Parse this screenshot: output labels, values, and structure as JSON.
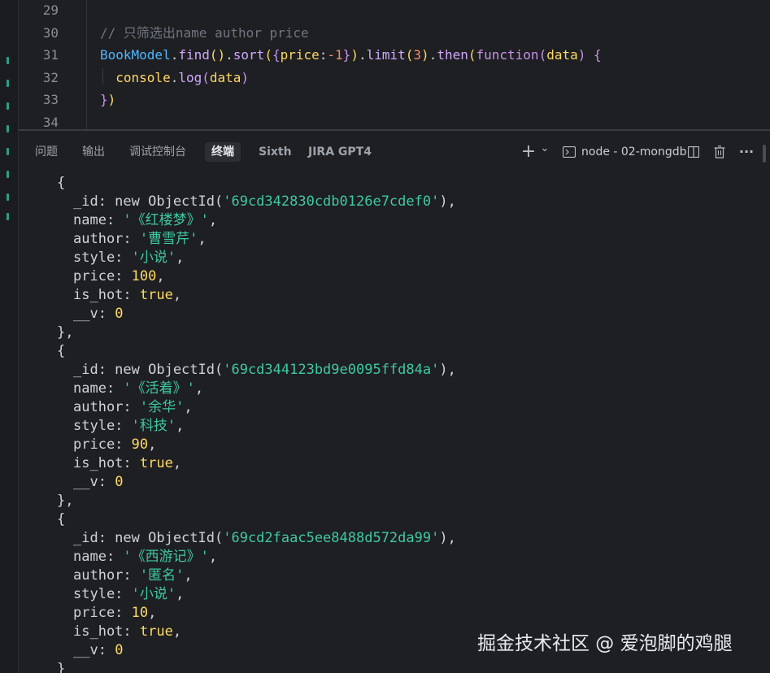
{
  "editor": {
    "lines": [
      {
        "no": "29",
        "segments": []
      },
      {
        "no": "30",
        "segments": [
          {
            "t": "// 只筛选出name author price",
            "c": "cm"
          }
        ]
      },
      {
        "no": "31",
        "segments": [
          {
            "t": "BookModel",
            "c": "cls"
          },
          {
            "t": ".",
            "c": "plain"
          },
          {
            "t": "find",
            "c": "fn"
          },
          {
            "t": "()",
            "c": "pn"
          },
          {
            "t": ".",
            "c": "plain"
          },
          {
            "t": "sort",
            "c": "fn"
          },
          {
            "t": "(",
            "c": "pn"
          },
          {
            "t": "{",
            "c": "fn2"
          },
          {
            "t": "price",
            "c": "pk"
          },
          {
            "t": ":",
            "c": "plain"
          },
          {
            "t": "-1",
            "c": "num"
          },
          {
            "t": "}",
            "c": "fn2"
          },
          {
            "t": ")",
            "c": "pn"
          },
          {
            "t": ".",
            "c": "plain"
          },
          {
            "t": "limit",
            "c": "fn"
          },
          {
            "t": "(",
            "c": "pn"
          },
          {
            "t": "3",
            "c": "num"
          },
          {
            "t": ")",
            "c": "pn"
          },
          {
            "t": ".",
            "c": "plain"
          },
          {
            "t": "then",
            "c": "fn"
          },
          {
            "t": "(",
            "c": "pn"
          },
          {
            "t": "function",
            "c": "kw"
          },
          {
            "t": "(",
            "c": "fn2"
          },
          {
            "t": "data",
            "c": "pk"
          },
          {
            "t": ")",
            "c": "fn2"
          },
          {
            "t": " ",
            "c": "plain"
          },
          {
            "t": "{",
            "c": "fn2"
          }
        ]
      },
      {
        "no": "32",
        "segments": [
          {
            "t": "  ",
            "c": "plain"
          },
          {
            "t": "console",
            "c": "pk"
          },
          {
            "t": ".",
            "c": "plain"
          },
          {
            "t": "log",
            "c": "fn"
          },
          {
            "t": "(",
            "c": "fn2"
          },
          {
            "t": "data",
            "c": "pk"
          },
          {
            "t": ")",
            "c": "fn2"
          }
        ]
      },
      {
        "no": "33",
        "segments": [
          {
            "t": "}",
            "c": "fn2"
          },
          {
            "t": ")",
            "c": "pn"
          }
        ]
      },
      {
        "no": "34",
        "segments": []
      }
    ]
  },
  "panel": {
    "tabs": [
      {
        "label": "问题",
        "active": false
      },
      {
        "label": "输出",
        "active": false
      },
      {
        "label": "调试控制台",
        "active": false
      },
      {
        "label": "终端",
        "active": true
      },
      {
        "label": "Sixth",
        "active": false
      },
      {
        "label": "JIRA GPT4",
        "active": false
      }
    ],
    "add_icon": "+",
    "dropdown_icon": "⌄",
    "terminal_icon": "terminal-icon",
    "terminal_name": "node - 02-mongdb",
    "split_icon": "◫",
    "trash_icon": "🗑",
    "more_icon": "···"
  },
  "terminal": {
    "lines": [
      {
        "indent": 2,
        "segments": [
          {
            "t": "{",
            "c": ""
          }
        ]
      },
      {
        "indent": 4,
        "segments": [
          {
            "t": "_id: new ObjectId(",
            "c": ""
          },
          {
            "t": "'69cd342830cdb0126e7cdef0'",
            "c": "tstr"
          },
          {
            "t": "),",
            "c": ""
          }
        ]
      },
      {
        "indent": 4,
        "segments": [
          {
            "t": "name: ",
            "c": ""
          },
          {
            "t": "'《红楼梦》'",
            "c": "tstr"
          },
          {
            "t": ",",
            "c": ""
          }
        ]
      },
      {
        "indent": 4,
        "segments": [
          {
            "t": "author: ",
            "c": ""
          },
          {
            "t": "'曹雪芹'",
            "c": "tstr"
          },
          {
            "t": ",",
            "c": ""
          }
        ]
      },
      {
        "indent": 4,
        "segments": [
          {
            "t": "style: ",
            "c": ""
          },
          {
            "t": "'小说'",
            "c": "tstr"
          },
          {
            "t": ",",
            "c": ""
          }
        ]
      },
      {
        "indent": 4,
        "segments": [
          {
            "t": "price: ",
            "c": ""
          },
          {
            "t": "100",
            "c": "tnum"
          },
          {
            "t": ",",
            "c": ""
          }
        ]
      },
      {
        "indent": 4,
        "segments": [
          {
            "t": "is_hot: ",
            "c": ""
          },
          {
            "t": "true",
            "c": "tbool"
          },
          {
            "t": ",",
            "c": ""
          }
        ]
      },
      {
        "indent": 4,
        "segments": [
          {
            "t": "__v: ",
            "c": ""
          },
          {
            "t": "0",
            "c": "tnum"
          }
        ]
      },
      {
        "indent": 2,
        "segments": [
          {
            "t": "},",
            "c": ""
          }
        ]
      },
      {
        "indent": 2,
        "segments": [
          {
            "t": "{",
            "c": ""
          }
        ]
      },
      {
        "indent": 4,
        "segments": [
          {
            "t": "_id: new ObjectId(",
            "c": ""
          },
          {
            "t": "'69cd344123bd9e0095ffd84a'",
            "c": "tstr"
          },
          {
            "t": "),",
            "c": ""
          }
        ]
      },
      {
        "indent": 4,
        "segments": [
          {
            "t": "name: ",
            "c": ""
          },
          {
            "t": "'《活着》'",
            "c": "tstr"
          },
          {
            "t": ",",
            "c": ""
          }
        ]
      },
      {
        "indent": 4,
        "segments": [
          {
            "t": "author: ",
            "c": ""
          },
          {
            "t": "'余华'",
            "c": "tstr"
          },
          {
            "t": ",",
            "c": ""
          }
        ]
      },
      {
        "indent": 4,
        "segments": [
          {
            "t": "style: ",
            "c": ""
          },
          {
            "t": "'科技'",
            "c": "tstr"
          },
          {
            "t": ",",
            "c": ""
          }
        ]
      },
      {
        "indent": 4,
        "segments": [
          {
            "t": "price: ",
            "c": ""
          },
          {
            "t": "90",
            "c": "tnum"
          },
          {
            "t": ",",
            "c": ""
          }
        ]
      },
      {
        "indent": 4,
        "segments": [
          {
            "t": "is_hot: ",
            "c": ""
          },
          {
            "t": "true",
            "c": "tbool"
          },
          {
            "t": ",",
            "c": ""
          }
        ]
      },
      {
        "indent": 4,
        "segments": [
          {
            "t": "__v: ",
            "c": ""
          },
          {
            "t": "0",
            "c": "tnum"
          }
        ]
      },
      {
        "indent": 2,
        "segments": [
          {
            "t": "},",
            "c": ""
          }
        ]
      },
      {
        "indent": 2,
        "segments": [
          {
            "t": "{",
            "c": ""
          }
        ]
      },
      {
        "indent": 4,
        "segments": [
          {
            "t": "_id: new ObjectId(",
            "c": ""
          },
          {
            "t": "'69cd2faac5ee8488d572da99'",
            "c": "tstr"
          },
          {
            "t": "),",
            "c": ""
          }
        ]
      },
      {
        "indent": 4,
        "segments": [
          {
            "t": "name: ",
            "c": ""
          },
          {
            "t": "'《西游记》'",
            "c": "tstr"
          },
          {
            "t": ",",
            "c": ""
          }
        ]
      },
      {
        "indent": 4,
        "segments": [
          {
            "t": "author: ",
            "c": ""
          },
          {
            "t": "'匿名'",
            "c": "tstr"
          },
          {
            "t": ",",
            "c": ""
          }
        ]
      },
      {
        "indent": 4,
        "segments": [
          {
            "t": "style: ",
            "c": ""
          },
          {
            "t": "'小说'",
            "c": "tstr"
          },
          {
            "t": ",",
            "c": ""
          }
        ]
      },
      {
        "indent": 4,
        "segments": [
          {
            "t": "price: ",
            "c": ""
          },
          {
            "t": "10",
            "c": "tnum"
          },
          {
            "t": ",",
            "c": ""
          }
        ]
      },
      {
        "indent": 4,
        "segments": [
          {
            "t": "is_hot: ",
            "c": ""
          },
          {
            "t": "true",
            "c": "tbool"
          },
          {
            "t": ",",
            "c": ""
          }
        ]
      },
      {
        "indent": 4,
        "segments": [
          {
            "t": "__v: ",
            "c": ""
          },
          {
            "t": "0",
            "c": "tnum"
          }
        ]
      },
      {
        "indent": 2,
        "segments": [
          {
            "t": "}",
            "c": ""
          }
        ]
      }
    ]
  },
  "watermark": "掘金技术社区 @ 爱泡脚的鸡腿"
}
